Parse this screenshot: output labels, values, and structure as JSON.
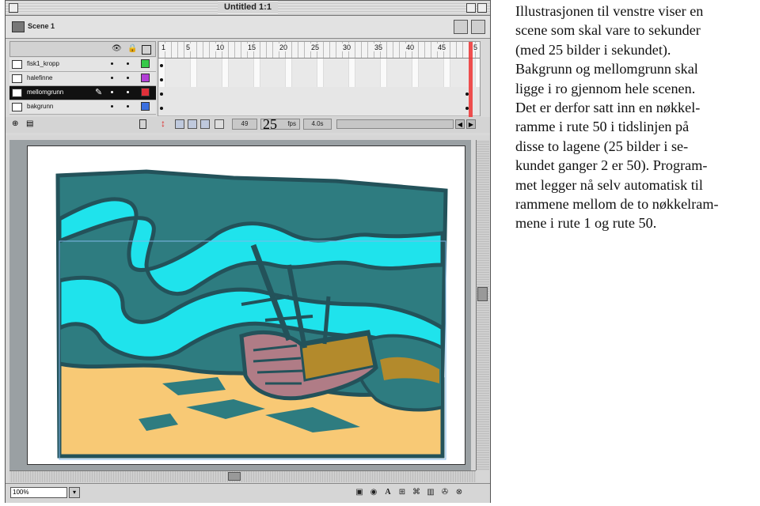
{
  "window": {
    "title": "Untitled 1:1",
    "scene_label": "Scene 1"
  },
  "timeline": {
    "frame_numbers": [
      "1",
      "5",
      "10",
      "15",
      "20",
      "25",
      "30",
      "35",
      "40",
      "45",
      "5"
    ],
    "layers": [
      {
        "name": "fisk1_kropp",
        "color": "#36c94a",
        "selected": false
      },
      {
        "name": "halefinne",
        "color": "#b23fd6",
        "selected": false
      },
      {
        "name": "mellomgrunn",
        "color": "#e0303a",
        "selected": true
      },
      {
        "name": "bakgrunn",
        "color": "#3a6fe0",
        "selected": false
      }
    ],
    "current_frame": "49",
    "fps_label": "fps",
    "fps_overlay": "25",
    "elapsed": "4.0s"
  },
  "statusbar": {
    "zoom": "100%"
  },
  "colors": {
    "teal_dark": "#2e7c80",
    "teal_mid": "#3b9ea0",
    "cyan": "#1fe3ec",
    "sand": "#f8c975",
    "ship_pink": "#b07c86",
    "ship_gold": "#b38a2c",
    "outline": "#23525a"
  },
  "caption_lines": [
    "Illustrasjonen til venstre viser en",
    "scene som skal vare to sekunder",
    "(med 25 bilder i sekundet).",
    "Bakgrunn og mellomgrunn skal",
    "ligge i ro gjennom hele scenen.",
    "Det er derfor satt inn en nøkkel-",
    "ramme i rute 50 i tidslinjen på",
    "disse to lagene (25 bilder i se-",
    "kundet ganger 2 er 50). Program-",
    "met legger nå selv automatisk til",
    "rammene mellom de to nøkkelram-",
    "mene i rute 1 og rute 50."
  ]
}
